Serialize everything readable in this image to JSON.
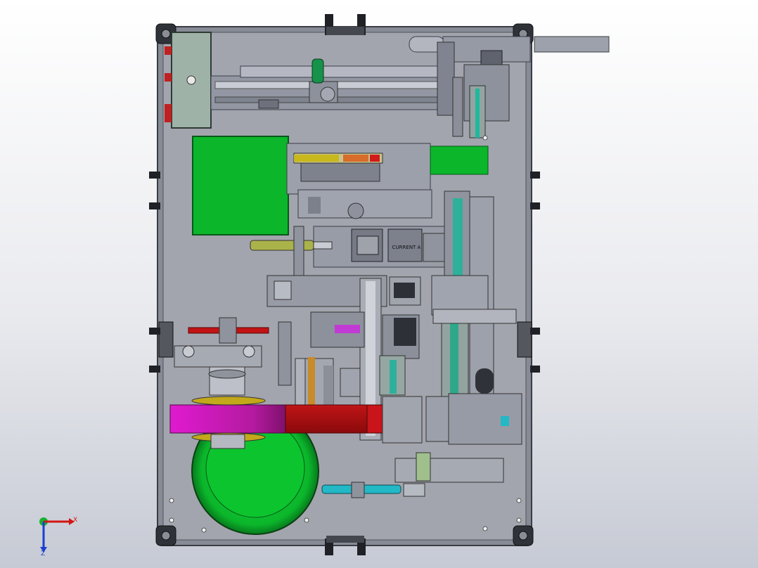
{
  "viewport": {
    "background_top": "#ffffff",
    "background_bottom": "#c6cad4"
  },
  "model": {
    "base_plate_color": "#a3a5ae",
    "frame_color": "#7e828c",
    "part_gray": "#8b8f9b",
    "part_light": "#b9bcc6",
    "green": "#0bb62b",
    "magenta": "#c81ab4",
    "red": "#b00f12",
    "cyan": "#22b8c6",
    "olive": "#a8a02a"
  },
  "labels": {
    "module_name": "CURRENT A"
  },
  "triad": {
    "x_label": "X",
    "z_label": "Z",
    "x_color": "#d41414",
    "z_color": "#1d3fd0",
    "y_color": "#19b030"
  }
}
